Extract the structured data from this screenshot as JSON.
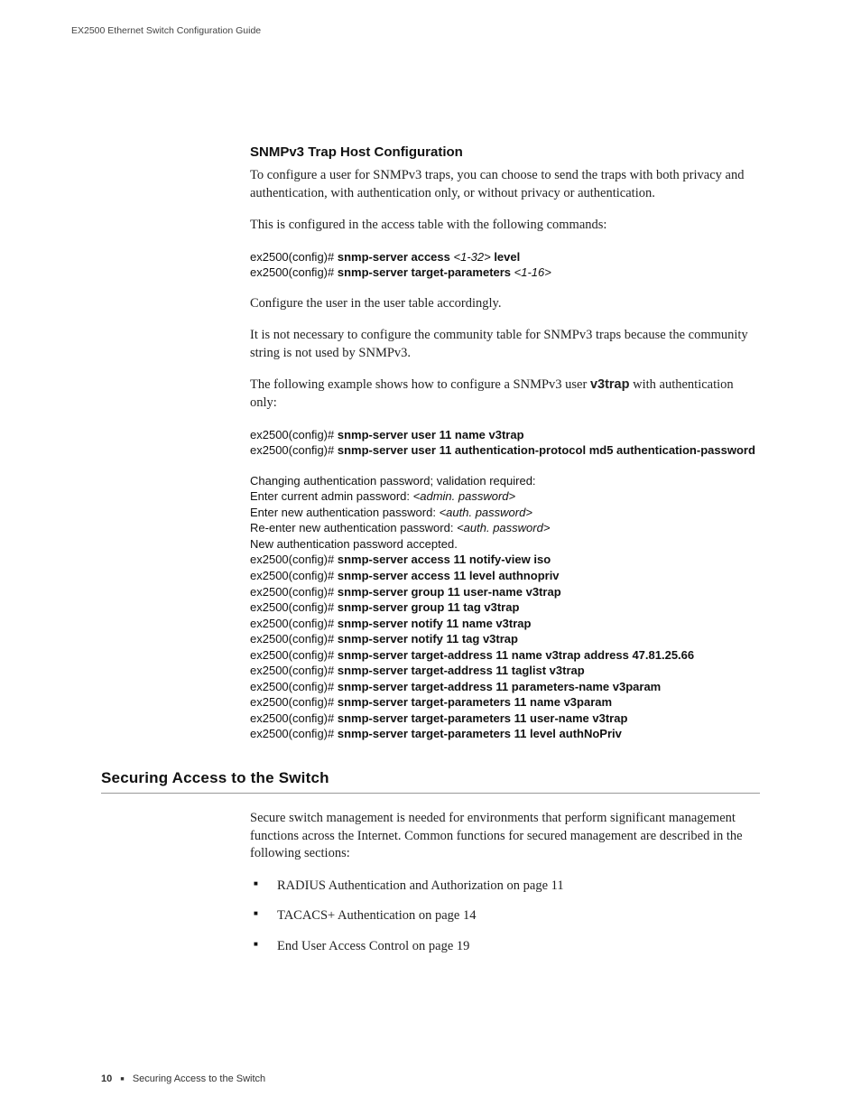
{
  "header": {
    "running": "EX2500 Ethernet Switch Configuration Guide"
  },
  "section1": {
    "title": "SNMPv3 Trap Host Configuration",
    "p1": "To configure a user for SNMPv3 traps, you can choose to send the traps with both privacy and authentication, with authentication only, or without privacy or authentication.",
    "p2": "This is configured in the access table with the following commands:",
    "code1": {
      "l1_pre": "ex2500(config)# ",
      "l1_bold": "snmp-server access ",
      "l1_it": "<1-32>",
      "l1_bold2": " level",
      "l2_pre": "ex2500(config)# ",
      "l2_bold": "snmp-server target-parameters ",
      "l2_it": "<1-16>"
    },
    "p3": "Configure the user in the user table accordingly.",
    "p4": "It is not necessary to configure the community table for SNMPv3 traps because the community string is not used by SNMPv3.",
    "p5_a": "The following example shows how to configure a SNMPv3 user ",
    "p5_b": "v3trap",
    "p5_c": " with authentication only:",
    "code2": {
      "l1_pre": "ex2500(config)# ",
      "l1_bold": "snmp-server user 11 name v3trap",
      "l2_pre": "ex2500(config)# ",
      "l2_bold": "snmp-server user 11 authentication-protocol md5 authentication-password"
    },
    "code3": {
      "l1": "Changing authentication password; validation required:",
      "l2a": "Enter current admin password: ",
      "l2b": "<admin. password>",
      "l3a": "Enter new authentication password: ",
      "l3b": "<auth. password>",
      "l4a": "Re-enter new authentication password: ",
      "l4b": "<auth. password>",
      "l5": "New authentication password accepted.",
      "rows": [
        {
          "pre": "ex2500(config)# ",
          "bold": "snmp-server access 11 notify-view iso"
        },
        {
          "pre": "ex2500(config)# ",
          "bold": "snmp-server access 11 level authnopriv"
        },
        {
          "pre": "ex2500(config)# ",
          "bold": "snmp-server group 11 user-name v3trap"
        },
        {
          "pre": "ex2500(config)# ",
          "bold": "snmp-server group 11 tag v3trap"
        },
        {
          "pre": "ex2500(config)# ",
          "bold": "snmp-server notify 11 name v3trap"
        },
        {
          "pre": "ex2500(config)# ",
          "bold": "snmp-server notify 11 tag v3trap"
        },
        {
          "pre": "ex2500(config)# ",
          "bold": "snmp-server target-address 11 name v3trap address 47.81.25.66"
        },
        {
          "pre": "ex2500(config)# ",
          "bold": "snmp-server target-address 11 taglist v3trap"
        },
        {
          "pre": "ex2500(config)# ",
          "bold": "snmp-server target-address 11 parameters-name v3param"
        },
        {
          "pre": "ex2500(config)# ",
          "bold": "snmp-server target-parameters 11 name v3param"
        },
        {
          "pre": "ex2500(config)# ",
          "bold": "snmp-server target-parameters 11 user-name v3trap"
        },
        {
          "pre": "ex2500(config)# ",
          "bold": "snmp-server target-parameters 11 level authNoPriv"
        }
      ]
    }
  },
  "section2": {
    "title": "Securing Access to the Switch",
    "p1": "Secure switch management is needed for environments that perform significant management functions across the Internet. Common functions for secured management are described in the following sections:",
    "bullets": [
      "RADIUS Authentication and Authorization on page 11",
      "TACACS+ Authentication on page 14",
      "End User Access Control on page 19"
    ]
  },
  "footer": {
    "page": "10",
    "text": "Securing Access to the Switch"
  }
}
